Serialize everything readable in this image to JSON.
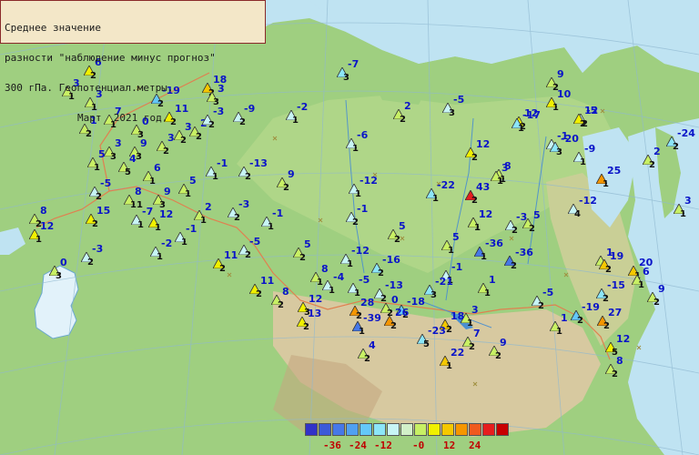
{
  "header": {
    "line1": "Среднее значение",
    "line2": "разности \"наблюдение минус прогноз\"",
    "line3": "300 гПа. Геопотенциал.метры.",
    "line4": "Март  2021 год."
  },
  "legend": {
    "colors": [
      "#3232c8",
      "#3c5ad8",
      "#4678e8",
      "#50a0f0",
      "#64c8f8",
      "#8ce6f8",
      "#c8f5f5",
      "#d2f0c8",
      "#c8f064",
      "#f0f000",
      "#f5c800",
      "#f59600",
      "#f05a1e",
      "#e61e1e",
      "#c80000"
    ],
    "labels": [
      "-36",
      "-24",
      "-12",
      "-0",
      "12",
      "24"
    ]
  },
  "stations": [
    {
      "v": "6",
      "n": "2",
      "c": "#f0f000"
    },
    {
      "v": "3",
      "n": "1",
      "c": "#c8f064"
    },
    {
      "v": "3",
      "n": "1",
      "c": "#c8f064"
    },
    {
      "v": "-19",
      "n": "2",
      "c": "#64c8f8"
    },
    {
      "v": "11",
      "n": "2",
      "c": "#f0f000"
    },
    {
      "v": "18",
      "n": "2",
      "c": "#f5c800"
    },
    {
      "v": "3",
      "n": "3",
      "c": "#c8f064"
    },
    {
      "v": "7",
      "n": "1",
      "c": "#c8f064"
    },
    {
      "v": "1",
      "n": "2",
      "c": "#c8f064"
    },
    {
      "v": "0",
      "n": "3",
      "c": "#c8f064"
    },
    {
      "v": "3",
      "n": "2",
      "c": "#c8f064"
    },
    {
      "v": "2",
      "n": "2",
      "c": "#c8f064"
    },
    {
      "v": "-3",
      "n": "2",
      "c": "#c8f5f5"
    },
    {
      "v": "-9",
      "n": "2",
      "c": "#c8f5f5"
    },
    {
      "v": "-2",
      "n": "1",
      "c": "#c8f5f5"
    },
    {
      "v": "-7",
      "n": "3",
      "c": "#8ce6f8"
    },
    {
      "v": "2",
      "n": "2",
      "c": "#c8f064"
    },
    {
      "v": "12",
      "n": "2",
      "c": "#f0f000"
    },
    {
      "v": "9",
      "n": "3",
      "c": "#c8f064"
    },
    {
      "v": "3",
      "n": "2",
      "c": "#c8f064"
    },
    {
      "v": "3",
      "n": "3",
      "c": "#c8f064"
    },
    {
      "v": "5",
      "n": "1",
      "c": "#c8f064"
    },
    {
      "v": "4",
      "n": "5",
      "c": "#c8f064"
    },
    {
      "v": "-1",
      "n": "1",
      "c": "#c8f5f5"
    },
    {
      "v": "6",
      "n": "1",
      "c": "#c8f064"
    },
    {
      "v": "-5",
      "n": "2",
      "c": "#c8f5f5"
    },
    {
      "v": "5",
      "n": "1",
      "c": "#c8f064"
    },
    {
      "v": "-13",
      "n": "2",
      "c": "#c8f5f5"
    },
    {
      "v": "9",
      "n": "2",
      "c": "#c8f064"
    },
    {
      "v": "-6",
      "n": "1",
      "c": "#c8f5f5"
    },
    {
      "v": "-5",
      "n": "3",
      "c": "#c8f5f5"
    },
    {
      "v": "12",
      "n": "2",
      "c": "#f0f000"
    },
    {
      "v": "8",
      "n": "1",
      "c": "#c8f064"
    },
    {
      "v": "-1",
      "n": "1",
      "c": "#c8f5f5"
    },
    {
      "v": "-5",
      "n": "2",
      "c": "#c8f5f5"
    },
    {
      "v": "8",
      "n": "11",
      "c": "#c8f064"
    },
    {
      "v": "9",
      "n": "3",
      "c": "#c8f064"
    },
    {
      "v": "-7",
      "n": "1",
      "c": "#c8f5f5"
    },
    {
      "v": "15",
      "n": "2",
      "c": "#f0f000"
    },
    {
      "v": "8",
      "n": "2",
      "c": "#c8f064"
    },
    {
      "v": "2",
      "n": "1",
      "c": "#c8f064"
    },
    {
      "v": "-3",
      "n": "2",
      "c": "#c8f5f5"
    },
    {
      "v": "-1",
      "n": "1",
      "c": "#c8f5f5"
    },
    {
      "v": "12",
      "n": "1",
      "c": "#f0f000"
    },
    {
      "v": "-12",
      "n": "1",
      "c": "#c8f5f5"
    },
    {
      "v": "-22",
      "n": "1",
      "c": "#8ce6f8"
    },
    {
      "v": "43",
      "n": "2",
      "c": "#e61e1e"
    },
    {
      "v": "3",
      "n": "1",
      "c": "#c8f064"
    },
    {
      "v": "5",
      "n": "2",
      "c": "#c8f064"
    },
    {
      "v": "12",
      "n": "1",
      "c": "#f0f000"
    },
    {
      "v": "-3",
      "n": "2",
      "c": "#c8f5f5"
    },
    {
      "v": "-1",
      "n": "1",
      "c": "#c8f5f5"
    },
    {
      "v": "-1",
      "n": "2",
      "c": "#c8f5f5"
    },
    {
      "v": "5",
      "n": "1",
      "c": "#c8f064"
    },
    {
      "v": "-36",
      "n": "1",
      "c": "#4678e8"
    },
    {
      "v": "-36",
      "n": "2",
      "c": "#4678e8"
    },
    {
      "v": "8",
      "n": "1",
      "c": "#c8f064"
    },
    {
      "v": "-5",
      "n": "2",
      "c": "#c8f5f5"
    },
    {
      "v": "11",
      "n": "2",
      "c": "#f0f000"
    },
    {
      "v": "-2",
      "n": "1",
      "c": "#c8f5f5"
    },
    {
      "v": "5",
      "n": "2",
      "c": "#c8f064"
    },
    {
      "v": "-12",
      "n": "1",
      "c": "#c8f5f5"
    },
    {
      "v": "-16",
      "n": "2",
      "c": "#8ce6f8"
    },
    {
      "v": "-1",
      "n": "1",
      "c": "#c8f5f5"
    },
    {
      "v": "1",
      "n": "1",
      "c": "#c8f064"
    },
    {
      "v": "-3",
      "n": "2",
      "c": "#c8f5f5"
    },
    {
      "v": "0",
      "n": "3",
      "c": "#c8f064"
    },
    {
      "v": "-4",
      "n": "1",
      "c": "#c8f5f5"
    },
    {
      "v": "-5",
      "n": "1",
      "c": "#c8f5f5"
    },
    {
      "v": "-13",
      "n": "2",
      "c": "#c8f5f5"
    },
    {
      "v": "-21",
      "n": "3",
      "c": "#8ce6f8"
    },
    {
      "v": "11",
      "n": "2",
      "c": "#f0f000"
    },
    {
      "v": "8",
      "n": "2",
      "c": "#c8f064"
    },
    {
      "v": "12",
      "n": "3",
      "c": "#f0f000"
    },
    {
      "v": "13",
      "n": "2",
      "c": "#f0f000"
    },
    {
      "v": "28",
      "n": "2",
      "c": "#f59600"
    },
    {
      "v": "-39",
      "n": "1",
      "c": "#4678e8"
    },
    {
      "v": "-18",
      "n": "2",
      "c": "#64c8f8"
    },
    {
      "v": "26",
      "n": "2",
      "c": "#f59600"
    },
    {
      "v": "3",
      "n": "1",
      "c": "#c8f064"
    },
    {
      "v": "18",
      "n": "2",
      "c": "#f5c800"
    },
    {
      "v": "-5",
      "n": "2",
      "c": "#c8f5f5"
    },
    {
      "v": "7",
      "n": "2",
      "c": "#c8f064"
    },
    {
      "v": "4",
      "n": "2",
      "c": "#c8f064"
    },
    {
      "v": "-23",
      "n": "5",
      "c": "#8ce6f8"
    },
    {
      "v": "22",
      "n": "1",
      "c": "#f5c800"
    },
    {
      "v": "9",
      "n": "2",
      "c": "#c8f064"
    },
    {
      "v": "9",
      "n": "2",
      "c": "#c8f064"
    },
    {
      "v": "10",
      "n": "1",
      "c": "#f0f000"
    },
    {
      "v": "-17",
      "n": "1",
      "c": "#8ce6f8"
    },
    {
      "v": "12",
      "n": "2",
      "c": "#f0f000"
    },
    {
      "v": "-20",
      "n": "3",
      "c": "#8ce6f8"
    },
    {
      "v": "-9",
      "n": "1",
      "c": "#c8f5f5"
    },
    {
      "v": "-24",
      "n": "2",
      "c": "#8ce6f8"
    },
    {
      "v": "2",
      "n": "2",
      "c": "#c8f064"
    },
    {
      "v": "25",
      "n": "1",
      "c": "#f59600"
    },
    {
      "v": "-12",
      "n": "4",
      "c": "#c8f5f5"
    },
    {
      "v": "3",
      "n": "1",
      "c": "#c8f064"
    },
    {
      "v": "1",
      "n": "2",
      "c": "#c8f064"
    },
    {
      "v": "20",
      "n": "1",
      "c": "#f5c800"
    },
    {
      "v": "6",
      "n": "1",
      "c": "#c8f064"
    },
    {
      "v": "-15",
      "n": "2",
      "c": "#8ce6f8"
    },
    {
      "v": "9",
      "n": "2",
      "c": "#c8f064"
    },
    {
      "v": "-19",
      "n": "2",
      "c": "#64c8f8"
    },
    {
      "v": "27",
      "n": "2",
      "c": "#f59600"
    },
    {
      "v": "1",
      "n": "1",
      "c": "#c8f064"
    },
    {
      "v": "12",
      "n": "5",
      "c": "#f0f000"
    },
    {
      "v": "8",
      "n": "2",
      "c": "#c8f064"
    },
    {
      "v": "1",
      "n": "1",
      "c": "#c8f064"
    },
    {
      "v": "19",
      "n": "2",
      "c": "#f5c800"
    },
    {
      "v": "12",
      "n": "1",
      "c": "#f0f000"
    },
    {
      "v": "0",
      "n": "2",
      "c": "#c8f064"
    },
    {
      "v": "5",
      "n": "2",
      "c": "#c8f064"
    },
    {
      "v": "-3",
      "n": "1",
      "c": "#c8f5f5"
    },
    {
      "v": "12",
      "n": "2",
      "c": "#f0f000"
    }
  ]
}
